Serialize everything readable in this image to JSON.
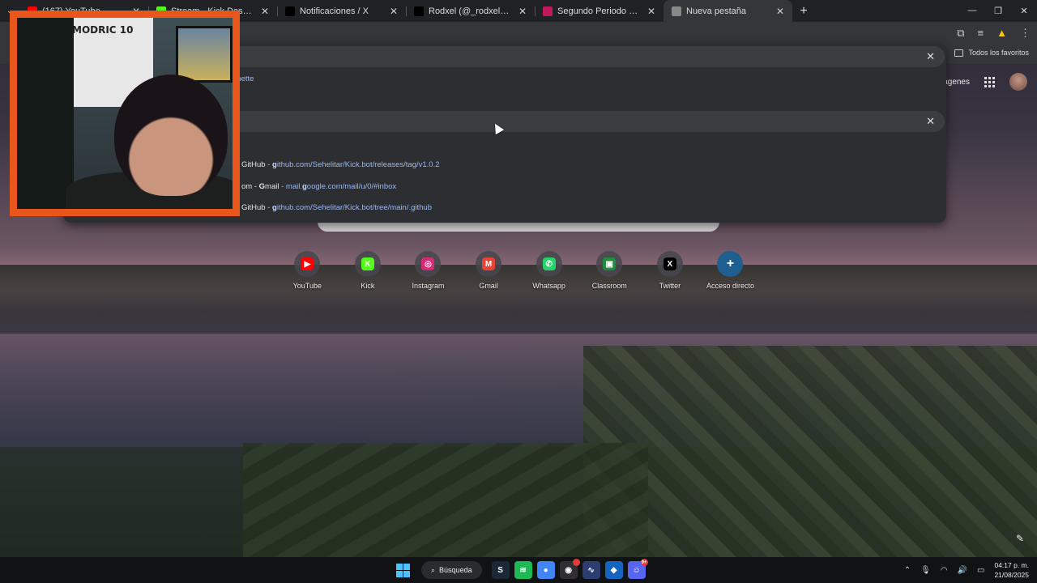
{
  "tabs": [
    {
      "title": "(167) YouTube",
      "icon": "youtube-icon",
      "color": "#ff0000"
    },
    {
      "title": "Stream - Kick Dashboard",
      "icon": "kick-icon",
      "color": "#53fc18"
    },
    {
      "title": "Notificaciones / X",
      "icon": "x-icon",
      "color": "#000000"
    },
    {
      "title": "Rodxel (@_rodxel_) | TikTok",
      "icon": "tiktok-icon",
      "color": "#000000"
    },
    {
      "title": "Segundo Periodo de Regulariza",
      "icon": "classroom-icon",
      "color": "#c2185b"
    },
    {
      "title": "Nueva pestaña",
      "icon": "chrome-icon",
      "color": "#888888",
      "active": true
    }
  ],
  "bookmarks": {
    "all_label": "Todos los favoritos"
  },
  "ntp": {
    "images_link": "mágenes"
  },
  "omnibox": {
    "partial_text": "gnette",
    "suggestions": [
      {
        "prefix": "GitHub",
        "sep": " - ",
        "url_bold": "g",
        "url_rest": "ithub.com/Sehelitar/Kick.bot/releases/tag/v1.0.2"
      },
      {
        "prefix": "om - ",
        "prefix_bold": "G",
        "prefix_rest": "mail",
        "sep": " - ",
        "url_pre": "mail.",
        "url_bold": "g",
        "url_rest": "oogle.com/mail/u/0/#inbox"
      },
      {
        "prefix": "GitHub",
        "sep": " - ",
        "url_bold": "g",
        "url_rest": "ithub.com/Sehelitar/Kick.bot/tree/main/.github"
      }
    ]
  },
  "shortcuts": [
    {
      "label": "YouTube",
      "icon": "youtube-icon",
      "color": "#ff0000",
      "glyph": "▶"
    },
    {
      "label": "Kick",
      "icon": "kick-icon",
      "color": "#53fc18",
      "glyph": "K"
    },
    {
      "label": "Instagram",
      "icon": "instagram-icon",
      "color": "#d62976",
      "glyph": "◎"
    },
    {
      "label": "Gmail",
      "icon": "gmail-icon",
      "color": "#ea4335",
      "glyph": "M"
    },
    {
      "label": "Whatsapp",
      "icon": "whatsapp-icon",
      "color": "#25d366",
      "glyph": "✆"
    },
    {
      "label": "Classroom",
      "icon": "classroom-icon",
      "color": "#1e8e3e",
      "glyph": "▣"
    },
    {
      "label": "Twitter",
      "icon": "x-icon",
      "color": "#000000",
      "glyph": "X"
    },
    {
      "label": "Acceso directo",
      "icon": "add-icon",
      "color": "#1f5f8f",
      "glyph": "+"
    }
  ],
  "webcam": {
    "shirt_text": "MODRIC 10"
  },
  "taskbar": {
    "search_label": "Búsqueda",
    "apps": [
      {
        "icon": "steam-icon",
        "color": "#1b2838",
        "glyph": "S"
      },
      {
        "icon": "spotify-icon",
        "color": "#1db954",
        "glyph": "≋"
      },
      {
        "icon": "chrome-icon",
        "color": "#4285f4",
        "glyph": "●"
      },
      {
        "icon": "obs-icon",
        "color": "#302e31",
        "glyph": "◉",
        "badge": ""
      },
      {
        "icon": "audio-app-icon",
        "color": "#2c3e70",
        "glyph": "∿"
      },
      {
        "icon": "vpn-icon",
        "color": "#1565c0",
        "glyph": "◆"
      },
      {
        "icon": "discord-icon",
        "color": "#5865f2",
        "glyph": "☺",
        "badge": "9+"
      }
    ],
    "time": "04:17 p. m.",
    "date": "21/08/2025"
  }
}
